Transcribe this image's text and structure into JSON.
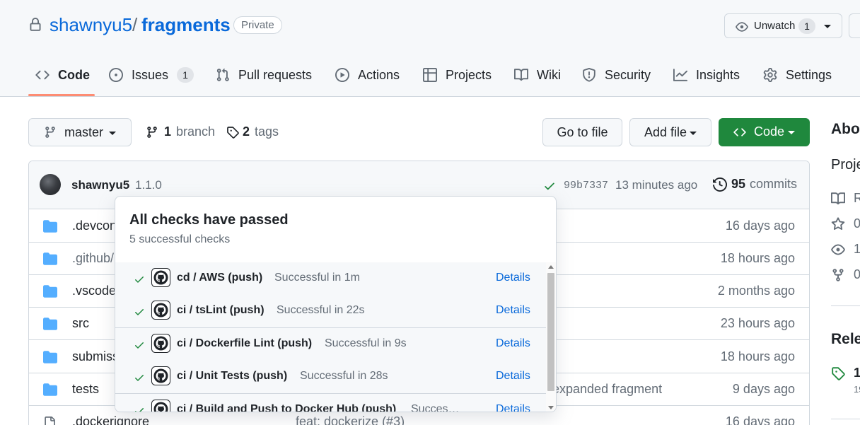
{
  "repo": {
    "owner": "shawnyu5",
    "separator": "/",
    "name": "fragments",
    "visibility": "Private",
    "watch_label": "Unwatch",
    "watch_count": "1"
  },
  "tabs": [
    {
      "label": "Code",
      "icon": "code-icon",
      "active": true
    },
    {
      "label": "Issues",
      "icon": "issue-icon",
      "count": "1"
    },
    {
      "label": "Pull requests",
      "icon": "pull-request-icon"
    },
    {
      "label": "Actions",
      "icon": "play-icon"
    },
    {
      "label": "Projects",
      "icon": "table-icon"
    },
    {
      "label": "Wiki",
      "icon": "book-icon"
    },
    {
      "label": "Security",
      "icon": "shield-icon"
    },
    {
      "label": "Insights",
      "icon": "graph-icon"
    },
    {
      "label": "Settings",
      "icon": "gear-icon"
    }
  ],
  "toolbar": {
    "branch_name": "master",
    "branch_count": "1",
    "branch_label": "branch",
    "tag_count": "2",
    "tag_label": "tags",
    "goto_file": "Go to file",
    "add_file": "Add file",
    "code_button": "Code"
  },
  "commit": {
    "author": "shawnyu5",
    "message": "1.1.0",
    "sha": "99b7337",
    "time": "13 minutes ago",
    "commit_count": "95",
    "commit_label": "commits"
  },
  "files": [
    {
      "name": ".devcon",
      "type": "folder",
      "message": "",
      "age": "16 days ago"
    },
    {
      "name": ".github/",
      "type": "folder",
      "message": "",
      "age": "18 hours ago"
    },
    {
      "name": ".vscode",
      "type": "folder",
      "message": "",
      "age": "2 months ago"
    },
    {
      "name": "src",
      "type": "folder",
      "message": "",
      "age": "23 hours ago"
    },
    {
      "name": "submiss",
      "type": "folder",
      "message": "",
      "age": "18 hours ago"
    },
    {
      "name": "tests",
      "type": "folder",
      "message": "expanded fragment",
      "age": "9 days ago"
    },
    {
      "name": ".dockerignore",
      "type": "file",
      "message": "feat: dockerize (#3)",
      "age": "16 days ago"
    }
  ],
  "about": {
    "title": "Abou",
    "description": "Proje",
    "rows": [
      {
        "icon": "book-icon",
        "text": "R"
      },
      {
        "icon": "star-icon",
        "text": "0"
      },
      {
        "icon": "eye-icon",
        "text": "1"
      },
      {
        "icon": "fork-icon",
        "text": "0"
      }
    ],
    "releases_title": "Rele",
    "release_tag": "1",
    "release_date": "19"
  },
  "checks": {
    "title": "All checks have passed",
    "subtitle": "5 successful checks",
    "items": [
      {
        "name": "cd / AWS (push)",
        "status": "Successful in 1m",
        "details": "Details"
      },
      {
        "name": "ci / tsLint (push)",
        "status": "Successful in 22s",
        "details": "Details"
      },
      {
        "name": "ci / Dockerfile Lint (push)",
        "status": "Successful in 9s",
        "details": "Details"
      },
      {
        "name": "ci / Unit Tests (push)",
        "status": "Successful in 28s",
        "details": "Details"
      },
      {
        "name": "ci / Build and Push to Docker Hub (push)",
        "status": "Succes…",
        "details": "Details"
      }
    ]
  },
  "colors": {
    "accent_blue": "#0969da",
    "success_green": "#1f883d",
    "tab_underline": "#fd8c73",
    "folder_blue": "#54aeff"
  }
}
